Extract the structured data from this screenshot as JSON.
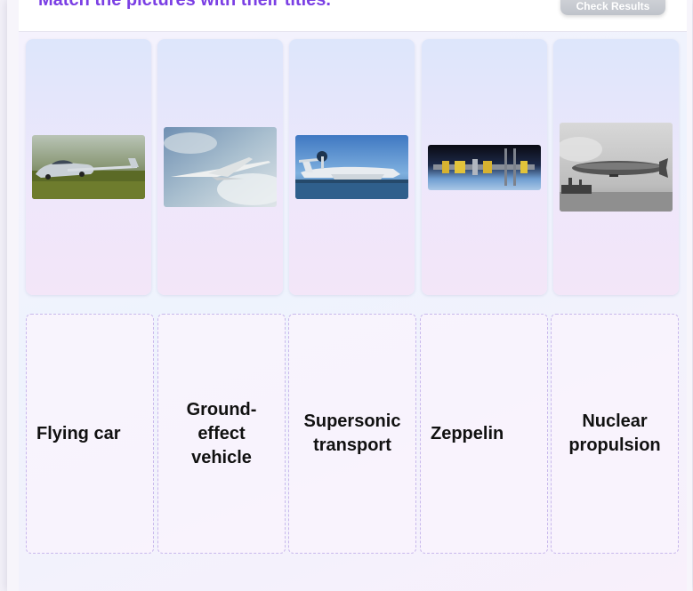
{
  "header": {
    "title": "Match the pictures with their titles.",
    "check_button": "Check Results"
  },
  "pictures": [
    {
      "icon": "flying-car-photo"
    },
    {
      "icon": "supersonic-jet-photo"
    },
    {
      "icon": "ground-effect-vehicle-photo"
    },
    {
      "icon": "nuclear-spacecraft-photo"
    },
    {
      "icon": "zeppelin-photo"
    }
  ],
  "titles": [
    {
      "label": "Flying car"
    },
    {
      "label": "Ground-effect vehicle"
    },
    {
      "label": "Supersonic transport"
    },
    {
      "label": "Zeppelin"
    },
    {
      "label": "Nuclear propulsion"
    }
  ],
  "colors": {
    "title": "#7b3fe4",
    "button": "#c7cad0",
    "slot_border": "#c8b8ec"
  }
}
